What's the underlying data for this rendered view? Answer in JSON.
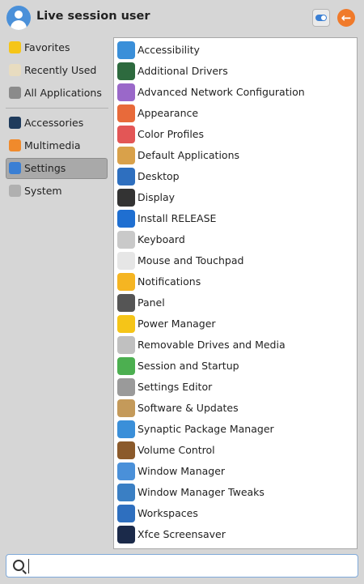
{
  "header": {
    "username": "Live session user",
    "settings_icon": "settings-toggle-icon",
    "logout_icon": "logout-arrow-icon"
  },
  "sidebar": {
    "items": [
      {
        "label": "Favorites",
        "icon": "star-icon",
        "color": "#f5c518",
        "active": false
      },
      {
        "label": "Recently Used",
        "icon": "clock-icon",
        "color": "#e8dcc0",
        "active": false
      },
      {
        "label": "All Applications",
        "icon": "gear-icon",
        "color": "#8b8b8b",
        "active": false
      },
      {
        "label": "Accessories",
        "icon": "waveform-icon",
        "color": "#1f3b5c",
        "active": false
      },
      {
        "label": "Multimedia",
        "icon": "music-note-icon",
        "color": "#f08a2c",
        "active": false
      },
      {
        "label": "Settings",
        "icon": "toggle-switch-icon",
        "color": "#3a7fd4",
        "active": true
      },
      {
        "label": "System",
        "icon": "cog-icon",
        "color": "#b0b0b0",
        "active": false
      }
    ]
  },
  "apps": [
    {
      "label": "Accessibility",
      "icon": "accessibility-icon",
      "color": "#3a8fd9"
    },
    {
      "label": "Additional Drivers",
      "icon": "driver-chip-icon",
      "color": "#2d6a3e"
    },
    {
      "label": "Advanced Network Configuration",
      "icon": "network-icon",
      "color": "#9a68c9"
    },
    {
      "label": "Appearance",
      "icon": "palette-icon",
      "color": "#e86a3a"
    },
    {
      "label": "Color Profiles",
      "icon": "color-circles-icon",
      "color": "#e35656"
    },
    {
      "label": "Default Applications",
      "icon": "folder-star-icon",
      "color": "#d9a14a"
    },
    {
      "label": "Desktop",
      "icon": "desktop-monitor-icon",
      "color": "#2e6fbf"
    },
    {
      "label": "Display",
      "icon": "display-monitor-icon",
      "color": "#333333"
    },
    {
      "label": "Install RELEASE",
      "icon": "installer-icon",
      "color": "#1f6fd1"
    },
    {
      "label": "Keyboard",
      "icon": "keyboard-icon",
      "color": "#c9c9c9"
    },
    {
      "label": "Mouse and Touchpad",
      "icon": "mouse-icon",
      "color": "#e6e6e6"
    },
    {
      "label": "Notifications",
      "icon": "bell-icon",
      "color": "#f5b522"
    },
    {
      "label": "Panel",
      "icon": "panel-icon",
      "color": "#555555"
    },
    {
      "label": "Power Manager",
      "icon": "power-bolt-icon",
      "color": "#f5c518"
    },
    {
      "label": "Removable Drives and Media",
      "icon": "usb-drive-icon",
      "color": "#c0c0c0"
    },
    {
      "label": "Session and Startup",
      "icon": "power-on-icon",
      "color": "#4caf50"
    },
    {
      "label": "Settings Editor",
      "icon": "gear-editor-icon",
      "color": "#9a9a9a"
    },
    {
      "label": "Software & Updates",
      "icon": "globe-package-icon",
      "color": "#c49a5a"
    },
    {
      "label": "Synaptic Package Manager",
      "icon": "download-arrow-icon",
      "color": "#3a8fd9"
    },
    {
      "label": "Volume Control",
      "icon": "speaker-icon",
      "color": "#8b5a2b"
    },
    {
      "label": "Window Manager",
      "icon": "windows-icon",
      "color": "#4a90d9"
    },
    {
      "label": "Window Manager Tweaks",
      "icon": "windows-tweak-icon",
      "color": "#3a7fc4"
    },
    {
      "label": "Workspaces",
      "icon": "workspaces-grid-icon",
      "color": "#2e6fbf"
    },
    {
      "label": "Xfce Screensaver",
      "icon": "screensaver-moon-icon",
      "color": "#1b2a4a"
    }
  ],
  "search": {
    "value": "",
    "icon": "search-icon"
  }
}
